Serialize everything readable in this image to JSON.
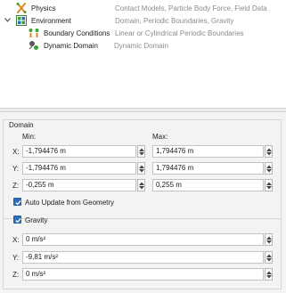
{
  "tree": {
    "items": [
      {
        "label": "Physics",
        "description": "Contact Models, Particle Body Force, Field Data",
        "icon": "physics-icon"
      },
      {
        "label": "Environment",
        "description": "Domain, Periodic Boundaries, Gravity",
        "icon": "environment-icon",
        "expanded": true
      },
      {
        "label": "Boundary Conditions",
        "description": "Linear or Cylindrical Periodic Boundaries",
        "icon": "boundary-conditions-icon"
      },
      {
        "label": "Dynamic Domain",
        "description": "Dynamic Domain",
        "icon": "dynamic-domain-icon"
      }
    ]
  },
  "domain": {
    "title": "Domain",
    "min_label": "Min:",
    "max_label": "Max:",
    "rows": [
      {
        "axis": "X:",
        "min": "-1,794476 m",
        "max": "1,794476 m"
      },
      {
        "axis": "Y:",
        "min": "-1,794476 m",
        "max": "1,794476 m"
      },
      {
        "axis": "Z:",
        "min": "-0,255 m",
        "max": "0,255 m"
      }
    ],
    "auto_update_label": "Auto Update from Geometry",
    "auto_update_checked": true
  },
  "gravity": {
    "title": "Gravity",
    "enabled": true,
    "rows": [
      {
        "axis": "X:",
        "value": "0 m/s²"
      },
      {
        "axis": "Y:",
        "value": "-9,81 m/s²"
      },
      {
        "axis": "Z:",
        "value": "0 m/s²"
      }
    ]
  },
  "colors": {
    "accent": "#2d6fb7",
    "description_text": "#8c8c8c",
    "panel_bg": "#f3f3f3"
  }
}
